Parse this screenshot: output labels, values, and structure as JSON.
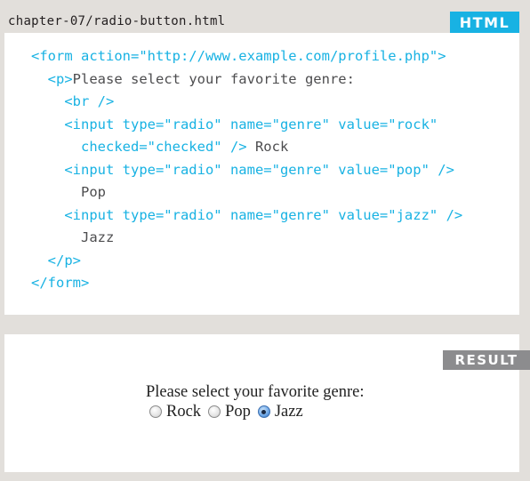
{
  "code_panel": {
    "file_path": "chapter-07/radio-button.html",
    "language_badge": "HTML",
    "lines": [
      [
        {
          "t": "tag",
          "v": "<form action=\"http://www.example.com/profile.php\">"
        }
      ],
      [
        {
          "t": "tag",
          "v": "  <p>"
        },
        {
          "t": "text",
          "v": "Please select your favorite genre:"
        }
      ],
      [
        {
          "t": "tag",
          "v": "    <br />"
        }
      ],
      [
        {
          "t": "tag",
          "v": "    <input type=\"radio\" name=\"genre\" value=\"rock\""
        }
      ],
      [
        {
          "t": "tag",
          "v": "      checked=\"checked\" />"
        },
        {
          "t": "text",
          "v": " Rock"
        }
      ],
      [
        {
          "t": "tag",
          "v": "    <input type=\"radio\" name=\"genre\" value=\"pop\" />"
        }
      ],
      [
        {
          "t": "text",
          "v": "      Pop"
        }
      ],
      [
        {
          "t": "tag",
          "v": "    <input type=\"radio\" name=\"genre\" value=\"jazz\" />"
        }
      ],
      [
        {
          "t": "text",
          "v": "      Jazz"
        }
      ],
      [
        {
          "t": "tag",
          "v": "  </p>"
        }
      ],
      [
        {
          "t": "tag",
          "v": "</form>"
        }
      ]
    ]
  },
  "result_panel": {
    "badge": "RESULT",
    "prompt": "Please select your favorite genre:",
    "options": [
      {
        "label": "Rock",
        "checked": false
      },
      {
        "label": "Pop",
        "checked": false
      },
      {
        "label": "Jazz",
        "checked": true
      }
    ]
  },
  "colors": {
    "tag": "#18b2e3",
    "text": "#4d4d4f",
    "badge_html": "#18b2e3",
    "badge_result": "#8c8c8e",
    "background": "#e2dfdb"
  }
}
